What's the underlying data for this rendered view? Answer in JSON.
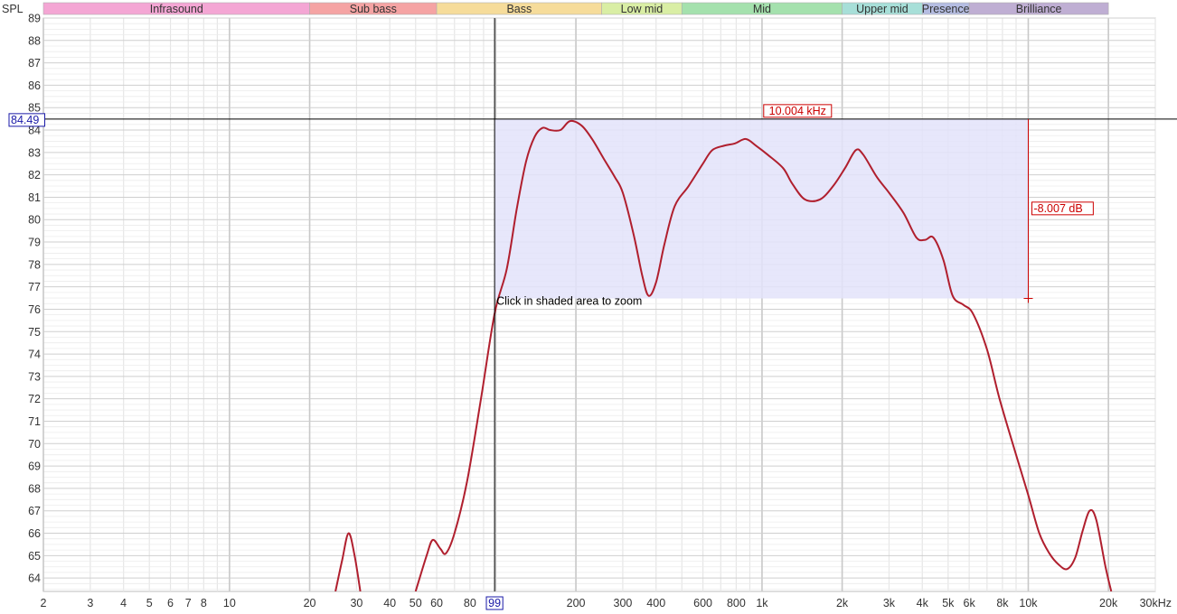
{
  "colors": {
    "curve": "#b01f2e",
    "selection_fill": "#e3e3fa",
    "cursor_label": "#1a1aa8",
    "annotation": "#cc0000",
    "grid_major": "#c8c8c8",
    "grid_minor": "#e6e6e6",
    "bands": [
      "#f4a6d4",
      "#f5a3a3",
      "#f6dc9a",
      "#d9eea4",
      "#a4e1ad",
      "#a7dfd8",
      "#b5bde2",
      "#bfaed3"
    ]
  },
  "chart_data": {
    "type": "line",
    "x_scale": "log",
    "xlim": [
      2,
      30000
    ],
    "ylim": [
      63.4,
      89
    ],
    "ylabel": "SPL",
    "xunit": "kHz",
    "grid": true,
    "frequency_bands": [
      {
        "label": "Infrasound",
        "from": 2,
        "to": 20
      },
      {
        "label": "Sub bass",
        "from": 20,
        "to": 60
      },
      {
        "label": "Bass",
        "from": 60,
        "to": 250
      },
      {
        "label": "Low mid",
        "from": 250,
        "to": 500
      },
      {
        "label": "Mid",
        "from": 500,
        "to": 2000
      },
      {
        "label": "Upper mid",
        "from": 2000,
        "to": 4000
      },
      {
        "label": "Presence",
        "from": 4000,
        "to": 6000
      },
      {
        "label": "Brilliance",
        "from": 6000,
        "to": 20000
      }
    ],
    "yticks": [
      64,
      65,
      66,
      67,
      68,
      69,
      70,
      71,
      72,
      73,
      74,
      75,
      76,
      77,
      78,
      79,
      80,
      81,
      82,
      83,
      84,
      85,
      86,
      87,
      88,
      89
    ],
    "xticks": [
      {
        "value": 2,
        "label": "2"
      },
      {
        "value": 3,
        "label": "3"
      },
      {
        "value": 4,
        "label": "4"
      },
      {
        "value": 5,
        "label": "5"
      },
      {
        "value": 6,
        "label": "6"
      },
      {
        "value": 7,
        "label": "7"
      },
      {
        "value": 8,
        "label": "8"
      },
      {
        "value": 10,
        "label": "10"
      },
      {
        "value": 20,
        "label": "20"
      },
      {
        "value": 30,
        "label": "30"
      },
      {
        "value": 40,
        "label": "40"
      },
      {
        "value": 50,
        "label": "50"
      },
      {
        "value": 60,
        "label": "60"
      },
      {
        "value": 80,
        "label": "80"
      },
      {
        "value": 200,
        "label": "200"
      },
      {
        "value": 300,
        "label": "300"
      },
      {
        "value": 400,
        "label": "400"
      },
      {
        "value": 600,
        "label": "600"
      },
      {
        "value": 800,
        "label": "800"
      },
      {
        "value": 1000,
        "label": "1k"
      },
      {
        "value": 2000,
        "label": "2k"
      },
      {
        "value": 3000,
        "label": "3k"
      },
      {
        "value": 4000,
        "label": "4k"
      },
      {
        "value": 5000,
        "label": "5k"
      },
      {
        "value": 6000,
        "label": "6k"
      },
      {
        "value": 8000,
        "label": "8k"
      },
      {
        "value": 10000,
        "label": "10k"
      },
      {
        "value": 20000,
        "label": "20k"
      },
      {
        "value": 30000,
        "label": "30kHz"
      }
    ],
    "series": [
      {
        "segments": [
          [
            [
              25,
              63.4
            ],
            [
              26.5,
              64.8
            ],
            [
              28,
              66.0
            ],
            [
              29.5,
              65.0
            ],
            [
              31,
              63.4
            ]
          ],
          [
            [
              50,
              63.4
            ],
            [
              55,
              65.0
            ],
            [
              58,
              65.7
            ],
            [
              62,
              65.3
            ],
            [
              65,
              65.1
            ],
            [
              70,
              66.0
            ],
            [
              78,
              68.3
            ],
            [
              88,
              72.0
            ],
            [
              99,
              75.8
            ],
            [
              110,
              77.8
            ],
            [
              120,
              80.5
            ],
            [
              130,
              82.6
            ],
            [
              140,
              83.7
            ],
            [
              150,
              84.1
            ],
            [
              160,
              84.0
            ],
            [
              175,
              84.0
            ],
            [
              190,
              84.4
            ],
            [
              210,
              84.2
            ],
            [
              230,
              83.6
            ],
            [
              255,
              82.7
            ],
            [
              280,
              81.9
            ],
            [
              300,
              81.2
            ],
            [
              330,
              79.3
            ],
            [
              355,
              77.5
            ],
            [
              375,
              76.6
            ],
            [
              400,
              77.2
            ],
            [
              430,
              78.9
            ],
            [
              470,
              80.6
            ],
            [
              530,
              81.5
            ],
            [
              600,
              82.5
            ],
            [
              650,
              83.1
            ],
            [
              720,
              83.3
            ],
            [
              790,
              83.4
            ],
            [
              870,
              83.6
            ],
            [
              950,
              83.3
            ],
            [
              1050,
              82.9
            ],
            [
              1200,
              82.3
            ],
            [
              1300,
              81.6
            ],
            [
              1450,
              80.9
            ],
            [
              1650,
              80.9
            ],
            [
              1850,
              81.5
            ],
            [
              2050,
              82.3
            ],
            [
              2250,
              83.1
            ],
            [
              2400,
              82.9
            ],
            [
              2700,
              81.9
            ],
            [
              3000,
              81.2
            ],
            [
              3400,
              80.3
            ],
            [
              3800,
              79.2
            ],
            [
              4100,
              79.1
            ],
            [
              4400,
              79.2
            ],
            [
              4800,
              78.2
            ],
            [
              5200,
              76.6
            ],
            [
              5700,
              76.2
            ],
            [
              6200,
              75.8
            ],
            [
              7000,
              74.2
            ],
            [
              7800,
              72.0
            ],
            [
              9000,
              69.5
            ],
            [
              10000,
              67.7
            ],
            [
              11000,
              66.0
            ],
            [
              12000,
              65.1
            ],
            [
              13000,
              64.6
            ],
            [
              14000,
              64.4
            ],
            [
              15000,
              64.9
            ],
            [
              16000,
              66.1
            ],
            [
              17000,
              67.0
            ],
            [
              18000,
              66.6
            ],
            [
              19500,
              64.5
            ],
            [
              20500,
              63.4
            ]
          ]
        ]
      }
    ],
    "cursor": {
      "frequency": 99,
      "frequency_label": "99",
      "spl_label": "84.49"
    },
    "selection": {
      "x_from": 99,
      "x_to": 10000,
      "y_from": 76.483,
      "y_to": 84.49
    },
    "annotations": {
      "frequency_readout": "10.004 kHz",
      "delta_readout": "-8.007 dB",
      "hint": "Click in shaded area to zoom"
    }
  }
}
